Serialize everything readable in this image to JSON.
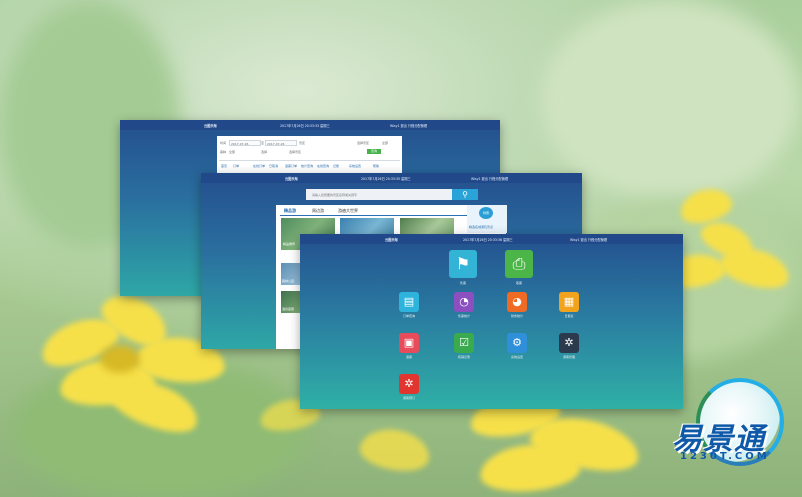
{
  "windows": {
    "back": {
      "title": "云图乐淘",
      "datetime": "2017年7月26日 20:33:33 星期三",
      "user": "Wisy1  退出  行程分配管理",
      "form": {
        "row1": [
          "时间",
          "2017-07-26",
          "至",
          "2017-07-26",
          "景区",
          "选择景区",
          "全部"
        ],
        "row2": [
          "票种",
          "全部",
          "选择",
          "选择景区"
        ],
        "search_button": "查询"
      },
      "nav": [
        "首页",
        "订单",
        "在线订单",
        "已取消",
        "退票订单",
        "统计查询",
        "在线查询",
        "记账",
        "系统设置",
        "帮助"
      ]
    },
    "middle": {
      "title": "云图乐淘",
      "datetime": "2017年7月26日 20:33:35 星期三",
      "user": "Wisy1  退出  行程分配管理",
      "search_placeholder": "请输入您想要的景区名称或关键字",
      "search_icon": "search-icon",
      "tabs": [
        "精品游",
        "周边游",
        "游遍大世界"
      ],
      "card_badge": "特惠",
      "side_text": "精选名城游玩景点",
      "thumb_captions": [
        "精品推荐",
        "森林公园",
        "温泉度假"
      ]
    },
    "front": {
      "title": "云图乐淘",
      "datetime": "2017年7月26日 20:33:36 星期三",
      "user": "Wisy1  退出  行程分配管理",
      "tiles": [
        {
          "label": "售票",
          "icon": "tag-icon",
          "color": "#33b3d6"
        },
        {
          "label": "取票",
          "icon": "printer-icon",
          "color": "#4cb548"
        },
        {
          "label": "订单查询",
          "icon": "card-icon",
          "color": "#2eb4dc"
        },
        {
          "label": "售票统计",
          "icon": "pie-chart-icon",
          "color": "#8b4fc0"
        },
        {
          "label": "财务统计",
          "icon": "pie-chart-icon",
          "color": "#ef6a23"
        },
        {
          "label": "日报表",
          "icon": "report-icon",
          "color": "#f2a31e"
        },
        {
          "label": "退票",
          "icon": "return-icon",
          "color": "#e84c5b"
        },
        {
          "label": "核销记录",
          "icon": "check-list-icon",
          "color": "#3aaa4f"
        },
        {
          "label": "系统设置",
          "icon": "gear-icon",
          "color": "#2f8fd8"
        },
        {
          "label": "游客管理",
          "icon": "glass-icon",
          "color": "#2b3a4d"
        },
        {
          "label": "游客预订",
          "icon": "glass-icon",
          "color": "#e23530"
        }
      ]
    }
  },
  "logo": {
    "name": "易景通",
    "domain": "1230T.COM"
  }
}
